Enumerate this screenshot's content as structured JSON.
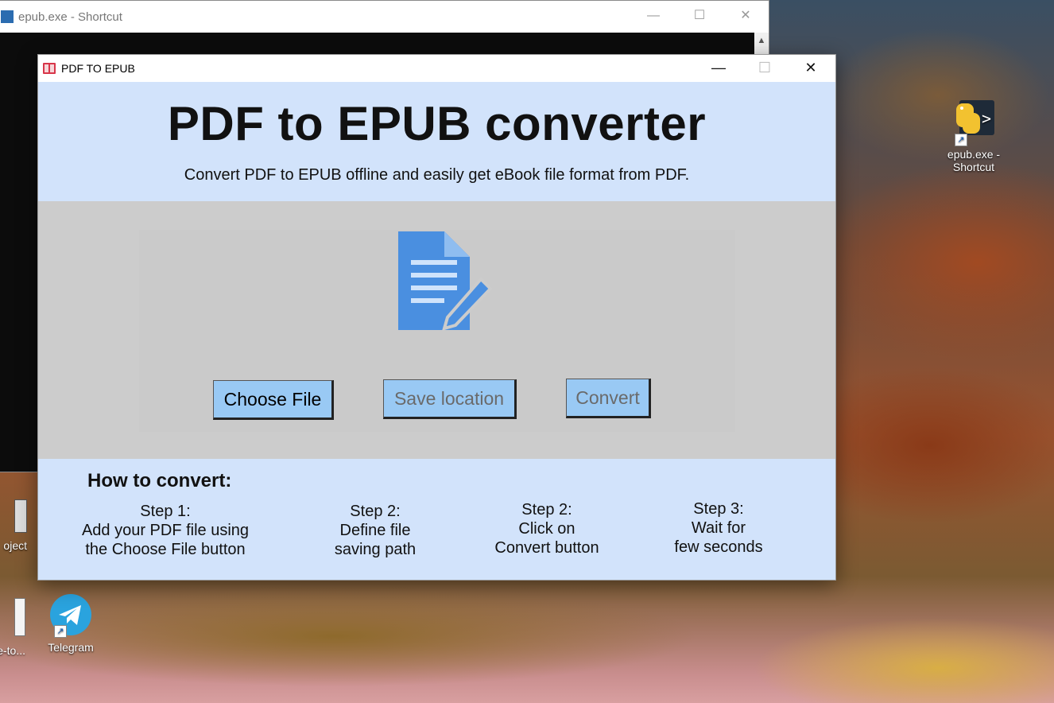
{
  "desktop": {
    "icons": [
      {
        "label": "epub.exe -\nShortcut",
        "label_line1": "epub.exe -",
        "label_line2": "Shortcut"
      },
      {
        "label": "Telegram"
      },
      {
        "label": "oject"
      },
      {
        "label": "e-to..."
      }
    ]
  },
  "console_window": {
    "title": "epub.exe - Shortcut",
    "controls": {
      "minimize": "—",
      "maximize": "☐",
      "close": "✕"
    }
  },
  "app_window": {
    "title": "PDF TO EPUB",
    "controls": {
      "minimize": "—",
      "maximize": "☐",
      "close": "✕"
    }
  },
  "header": {
    "title": "PDF to EPUB converter",
    "subtitle": "Convert PDF to EPUB offline and easily get eBook file format from PDF."
  },
  "buttons": {
    "choose_file": {
      "label": "Choose File",
      "state": "enabled"
    },
    "save_location": {
      "label": "Save location",
      "state": "disabled"
    },
    "convert": {
      "label": "Convert",
      "state": "disabled"
    }
  },
  "howto": {
    "heading": "How to convert:",
    "steps": [
      {
        "title": "Step 1:",
        "line1": "Add your PDF file using",
        "line2": "the Choose File button"
      },
      {
        "title": "Step 2:",
        "line1": "Define file",
        "line2": "saving path"
      },
      {
        "title": "Step 2:",
        "line1": "Click on",
        "line2": "Convert button"
      },
      {
        "title": "Step 3:",
        "line1": "Wait for",
        "line2": "few seconds"
      }
    ]
  },
  "colors": {
    "header_bg": "#d2e3fb",
    "middle_bg": "#cccccc",
    "button_bg": "#99c9f4",
    "doc_icon": "#4a8fe0"
  }
}
